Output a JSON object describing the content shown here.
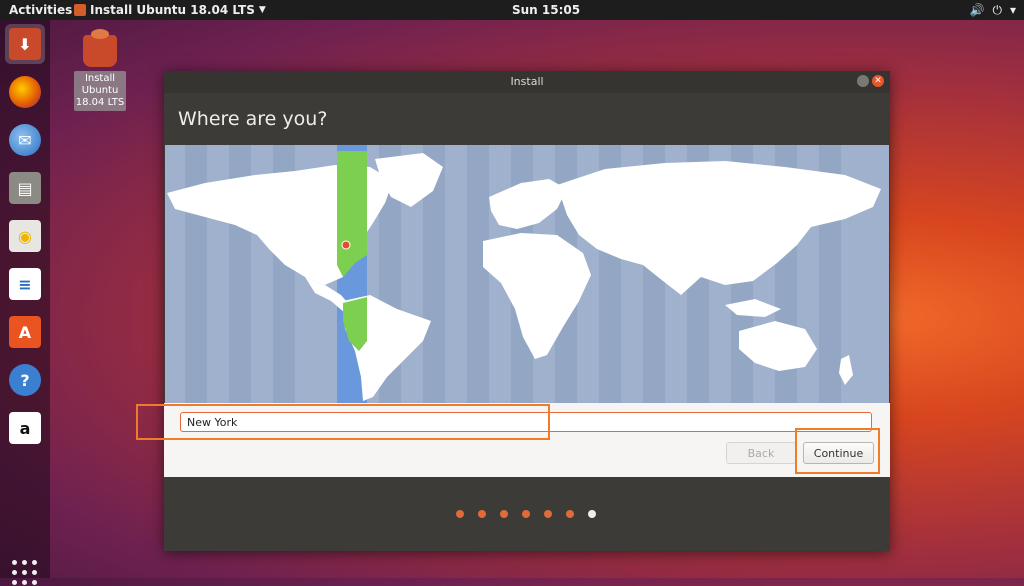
{
  "topbar": {
    "activities": "Activities",
    "app_name": "Install Ubuntu 18.04 LTS",
    "clock": "Sun 15:05"
  },
  "dock": {
    "items": [
      {
        "name": "ubuntu-installer",
        "color": "#c94a2a"
      },
      {
        "name": "firefox",
        "color": "#e66000"
      },
      {
        "name": "thunderbird",
        "color": "#2a6ebf"
      },
      {
        "name": "files",
        "color": "#8c8a85"
      },
      {
        "name": "rhythmbox",
        "color": "#f0b400"
      },
      {
        "name": "libreoffice-writer",
        "color": "#2a6ebf"
      },
      {
        "name": "ubuntu-software",
        "color": "#e95420"
      },
      {
        "name": "help",
        "color": "#3b7fd1"
      },
      {
        "name": "amazon",
        "color": "#ffffff"
      }
    ]
  },
  "desktop": {
    "icon_label_lines": [
      "Install",
      "Ubuntu",
      "18.04 LTS"
    ]
  },
  "window": {
    "title": "Install",
    "heading": "Where are you?",
    "city_value": "New York",
    "back_label": "Back",
    "continue_label": "Continue",
    "progress": {
      "total": 7,
      "current": 7
    }
  },
  "colors": {
    "accent": "#e95420",
    "map_water": "#9fb1cc",
    "map_land": "#ffffff",
    "timezone_highlight": "#6a98dd",
    "timezone_land": "#7ccf4f",
    "highlight_box": "#f07c2a"
  }
}
